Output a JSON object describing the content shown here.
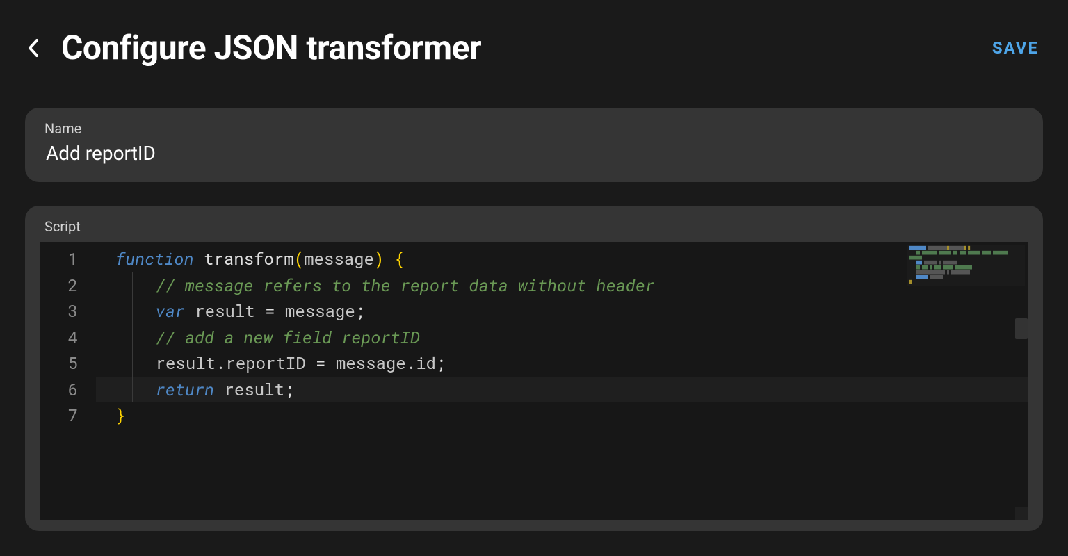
{
  "header": {
    "title": "Configure JSON transformer",
    "save_label": "SAVE"
  },
  "name_field": {
    "label": "Name",
    "value": "Add reportID"
  },
  "script_field": {
    "label": "Script",
    "line_numbers": [
      "1",
      "2",
      "3",
      "4",
      "5",
      "6",
      "7"
    ],
    "code": {
      "l1": {
        "kw": "function",
        "sp1": " ",
        "fn": "transform",
        "po": "(",
        "arg": "message",
        "pc": ")",
        "sp2": " ",
        "ob": "{"
      },
      "l2": {
        "indent": "    ",
        "cm": "// message refers to the report data without header"
      },
      "l3": {
        "indent": "    ",
        "kw": "var",
        "sp": " ",
        "id": "result",
        "eq": " = ",
        "rhs": "message",
        "sc": ";"
      },
      "l4": {
        "indent": "    ",
        "cm": "// add a new field reportID"
      },
      "l5": {
        "indent": "    ",
        "lhs": "result.reportID",
        "eq": " = ",
        "rhs": "message.id",
        "sc": ";"
      },
      "l6": {
        "indent": "    ",
        "kw": "return",
        "sp": " ",
        "id": "result",
        "sc": ";"
      },
      "l7": {
        "cb": "}"
      }
    }
  }
}
